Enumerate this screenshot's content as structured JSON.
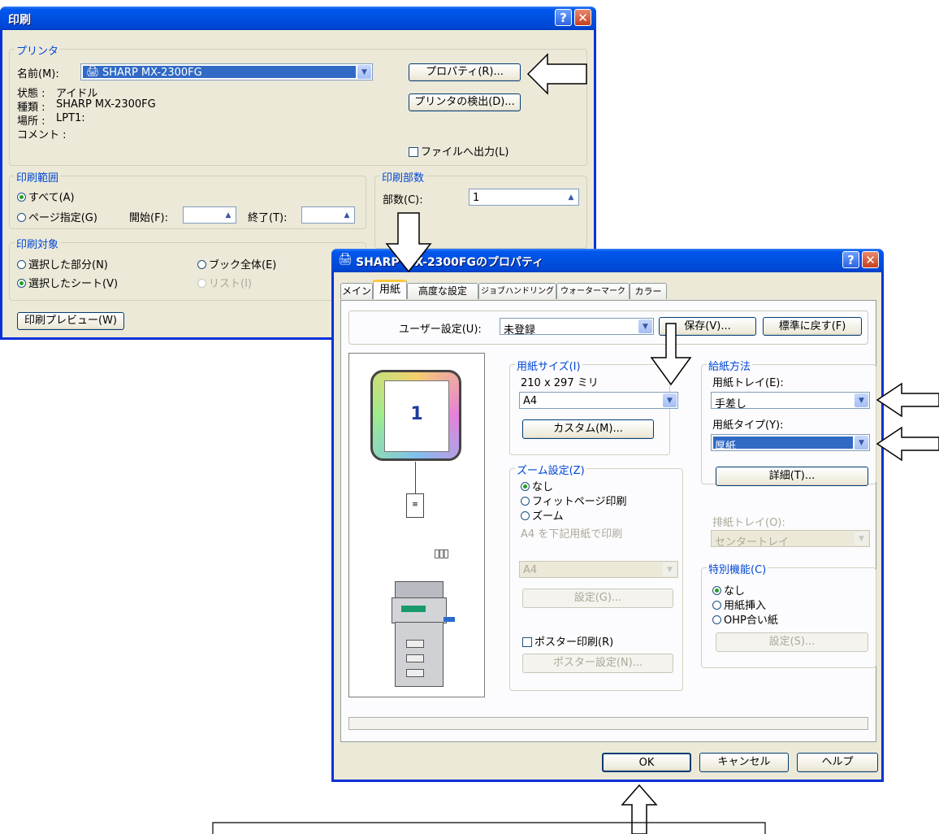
{
  "print_dialog": {
    "title": "印刷",
    "help_btn": "?",
    "close_btn": "✕",
    "printer_group": "プリンタ",
    "name_label": "名前(M):",
    "printer_name": "SHARP MX-2300FG",
    "status_label": "状態 :",
    "status_value": "アイドル",
    "type_label": "種類 :",
    "type_value": "SHARP MX-2300FG",
    "where_label": "場所 :",
    "where_value": "LPT1:",
    "comment_label": "コメント :",
    "properties_btn": "プロパティ(R)...",
    "find_printer_btn": "プリンタの検出(D)...",
    "print_to_file": "ファイルへ出力(L)",
    "range_group": "印刷範囲",
    "range_all": "すべて(A)",
    "range_pages": "ページ指定(G)",
    "from_label": "開始(F):",
    "to_label": "終了(T):",
    "copies_group": "印刷部数",
    "copies_label": "部数(C):",
    "copies_value": "1",
    "target_group": "印刷対象",
    "target_selection": "選択した部分(N)",
    "target_workbook": "ブック全体(E)",
    "target_sheet": "選択したシート(V)",
    "target_list": "リスト(I)",
    "preview_btn": "印刷プレビュー(W)"
  },
  "props_dialog": {
    "title": "SHARP MX-2300FGのプロパティ",
    "help_btn": "?",
    "close_btn": "✕",
    "tabs": [
      "メイン",
      "用紙",
      "高度な設定",
      "ジョブハンドリング",
      "ウォーターマーク",
      "カラー"
    ],
    "user_setting_label": "ユーザー設定(U):",
    "user_setting_value": "未登録",
    "save_btn": "保存(V)...",
    "default_btn": "標準に戻す(F)",
    "preview_page_number": "1",
    "paper_size_group": "用紙サイズ(I)",
    "paper_size_dims": "210 x 297 ミリ",
    "paper_size_value": "A4",
    "custom_btn": "カスタム(M)...",
    "zoom_group": "ズーム設定(Z)",
    "zoom_none": "なし",
    "zoom_fit": "フィットページ印刷",
    "zoom_zoom": "ズーム",
    "zoom_desc": "A4 を下記用紙で印刷",
    "zoom_paper_value": "A4",
    "zoom_settings_btn": "設定(G)...",
    "poster_print": "ポスター印刷(R)",
    "poster_settings_btn": "ポスター設定(N)...",
    "paper_source_group": "給紙方法",
    "tray_label": "用紙トレイ(E):",
    "tray_value": "手差し",
    "paper_type_label": "用紙タイプ(Y):",
    "paper_type_value": "厚紙",
    "details_btn": "詳細(T)...",
    "output_tray_label": "排紙トレイ(O):",
    "output_tray_value": "センタートレイ",
    "special_group": "特別機能(C)",
    "special_none": "なし",
    "special_insert": "用紙挿入",
    "special_ohp": "OHP合い紙",
    "special_settings_btn": "設定(S)...",
    "ok_btn": "OK",
    "cancel_btn": "キャンセル",
    "help_button": "ヘルプ"
  },
  "colors": {
    "titlebar": "#0058ee",
    "dialog_bg": "#ece9d8",
    "group_label": "#0046d5",
    "selection": "#316ac5"
  }
}
